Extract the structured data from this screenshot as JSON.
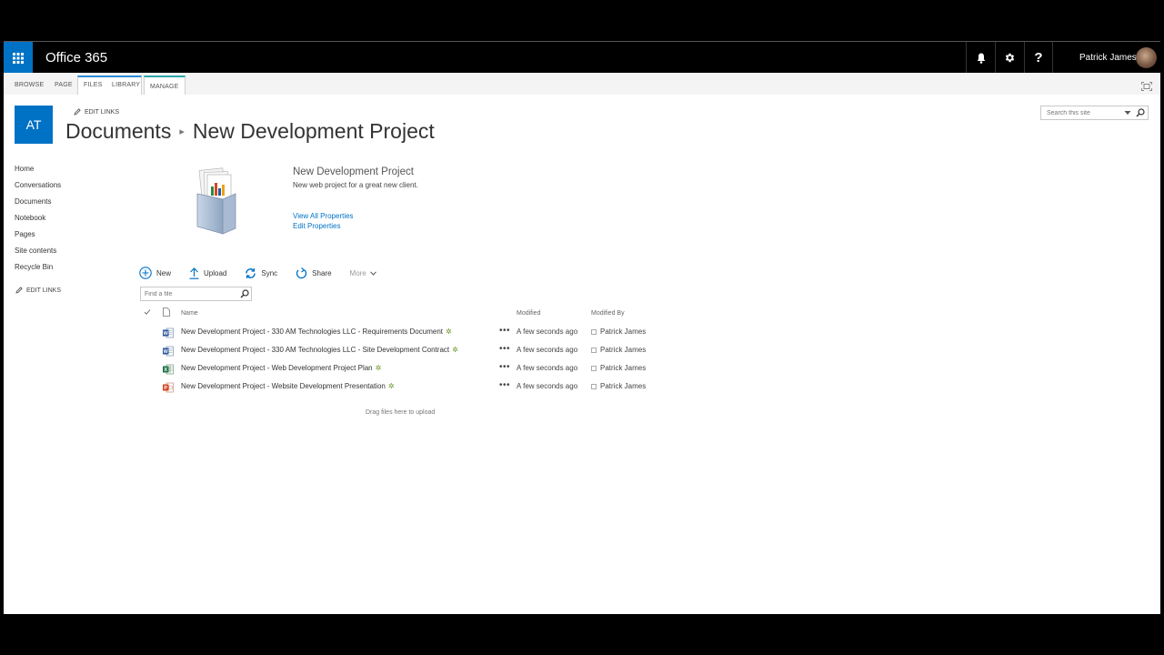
{
  "suitebar": {
    "brand": "Office 365",
    "user_name": "Patrick James",
    "icons": [
      "waffle-icon",
      "bell-icon",
      "gear-icon",
      "help-icon"
    ]
  },
  "ribbon": {
    "tabs": [
      "BROWSE",
      "PAGE",
      "FILES",
      "LIBRARY",
      "MANAGE"
    ]
  },
  "site": {
    "logo_text": "AT",
    "edit_links": "EDIT LINKS",
    "breadcrumb_root": "Documents",
    "breadcrumb_current": "New Development Project"
  },
  "search": {
    "placeholder": "Search this site"
  },
  "leftnav": {
    "items": [
      "Home",
      "Conversations",
      "Documents",
      "Notebook",
      "Pages",
      "Site contents",
      "Recycle Bin"
    ],
    "edit_links": "EDIT LINKS"
  },
  "folder": {
    "title": "New Development Project",
    "description": "New web project for a great new client.",
    "view_all_properties": "View All Properties",
    "edit_properties": "Edit Properties"
  },
  "commands": {
    "new": "New",
    "upload": "Upload",
    "sync": "Sync",
    "share": "Share",
    "more": "More"
  },
  "find": {
    "placeholder": "Find a file"
  },
  "list": {
    "headers": {
      "name": "Name",
      "modified": "Modified",
      "modified_by": "Modified By"
    },
    "rows": [
      {
        "name": "New Development Project - 330 AM Technologies LLC - Requirements Document",
        "type": "word",
        "modified": "A few seconds ago",
        "modified_by": "Patrick James"
      },
      {
        "name": "New Development Project - 330 AM Technologies LLC - Site Development Contract",
        "type": "word",
        "modified": "A few seconds ago",
        "modified_by": "Patrick James"
      },
      {
        "name": "New Development Project - Web Development Project Plan",
        "type": "excel",
        "modified": "A few seconds ago",
        "modified_by": "Patrick James"
      },
      {
        "name": "New Development Project - Website Development Presentation",
        "type": "powerpoint",
        "modified": "A few seconds ago",
        "modified_by": "Patrick James"
      }
    ],
    "new_badge": "✲",
    "drag_hint": "Drag files here to upload"
  },
  "colors": {
    "accent": "#0072c6",
    "word": "#2b579a",
    "excel": "#217346",
    "powerpoint": "#d24726"
  }
}
